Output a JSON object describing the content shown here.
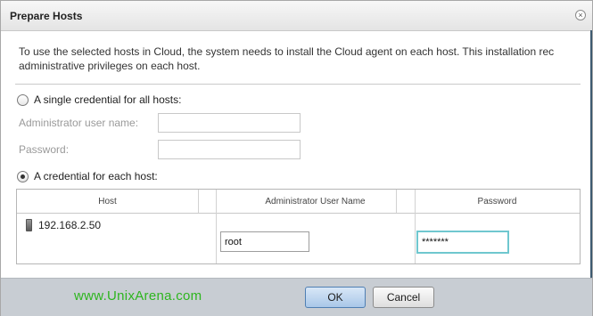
{
  "dialog": {
    "title": "Prepare Hosts",
    "close_icon": "×"
  },
  "intro": {
    "line1": "To use the selected hosts in Cloud, the system needs to install the Cloud agent on each host. This installation rec",
    "line2": "administrative privileges on each host."
  },
  "single_credential": {
    "label": "A single credential for all hosts:",
    "checked": false,
    "user_label": "Administrator user name:",
    "user_value": "",
    "password_label": "Password:",
    "password_value": ""
  },
  "per_host_credential": {
    "label": "A credential for each host:",
    "checked": true
  },
  "grid": {
    "columns": [
      "Host",
      "Administrator User Name",
      "Password"
    ],
    "rows": [
      {
        "host": "192.168.2.50",
        "user": "root",
        "password": "*******"
      }
    ]
  },
  "footer": {
    "watermark": "www.UnixArena.com",
    "ok_label": "OK",
    "cancel_label": "Cancel"
  }
}
